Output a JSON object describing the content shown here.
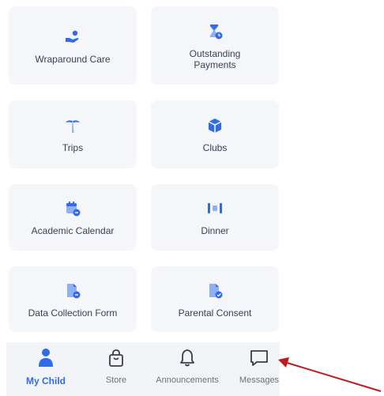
{
  "colors": {
    "accent": "#2f6bea",
    "tile_bg": "#f5f6fa",
    "annotation_arrow": "#c0191f"
  },
  "tiles": [
    {
      "label": "Wraparound Care",
      "icon": "hand-coin-icon"
    },
    {
      "label": "Outstanding Payments",
      "icon": "hourglass-icon"
    },
    {
      "label": "Trips",
      "icon": "palm-tree-icon"
    },
    {
      "label": "Clubs",
      "icon": "cube-icon"
    },
    {
      "label": "Academic Calendar",
      "icon": "calendar-icon"
    },
    {
      "label": "Dinner",
      "icon": "cutlery-icon"
    },
    {
      "label": "Data Collection Form",
      "icon": "document-icon"
    },
    {
      "label": "Parental Consent",
      "icon": "document-check-icon"
    }
  ],
  "tabbar": {
    "tabs": [
      {
        "label": "My Child",
        "icon": "person-icon",
        "active": true
      },
      {
        "label": "Store",
        "icon": "shopping-bag-icon",
        "active": false
      },
      {
        "label": "Announcements",
        "icon": "bell-icon",
        "active": false
      },
      {
        "label": "Messages",
        "icon": "chat-bubble-icon",
        "active": false
      }
    ]
  }
}
